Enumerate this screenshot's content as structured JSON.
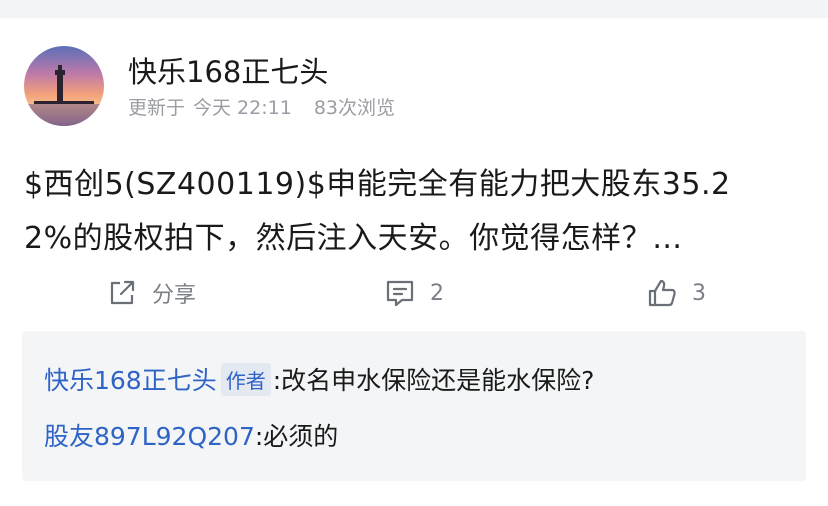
{
  "post": {
    "author": "快乐168正七头",
    "updated_label": "更新于",
    "time": "今天 22:11",
    "views": "83次浏览",
    "content_line1": "$西创5(SZ400119)$申能完全有能力把大股东35.2",
    "content_line2": "2%的股权拍下，然后注入天安。你觉得怎样？…"
  },
  "actions": {
    "share_label": "分享",
    "comment_count": "2",
    "like_count": "3"
  },
  "replies": [
    {
      "user": "快乐168正七头",
      "tag": "作者",
      "text": ":改名申水保险还是能水保险?"
    },
    {
      "user": "股友897L92Q207",
      "tag": "",
      "text": ":必须的"
    }
  ],
  "icons": {
    "share": "share-icon",
    "comment": "comment-icon",
    "like": "thumbs-up-icon"
  },
  "colors": {
    "link_blue": "#2f63c6",
    "muted_gray": "#9a9da3",
    "reply_bg": "#f4f5f7"
  }
}
